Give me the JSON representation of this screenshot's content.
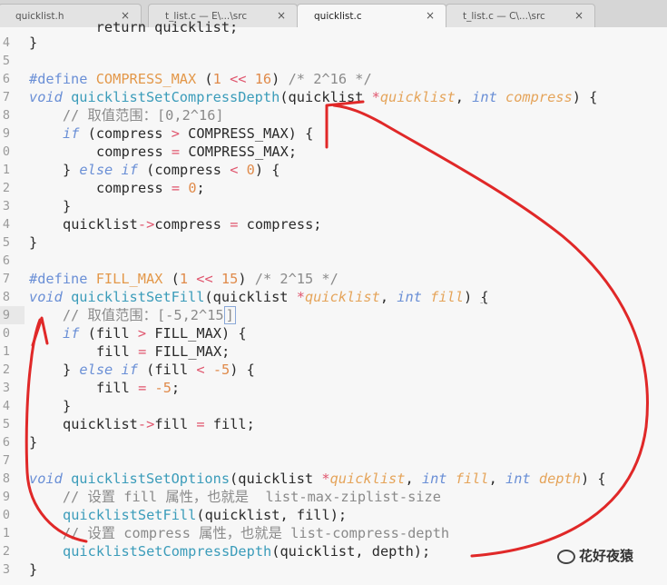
{
  "tabs": [
    {
      "label": "quicklist.h",
      "active": false
    },
    {
      "label": "t_list.c — E\\...\\src",
      "active": false
    },
    {
      "label": "quicklist.c",
      "active": true
    },
    {
      "label": "t_list.c — C\\...\\src",
      "active": false
    }
  ],
  "tab_close_glyph": "×",
  "line_numbers": [
    "4",
    "5",
    "6",
    "7",
    "8",
    "9",
    "0",
    "1",
    "2",
    "3",
    "4",
    "5",
    "6",
    "7",
    "8",
    "9",
    "0",
    "1",
    "2",
    "3",
    "4",
    "5",
    "6",
    "7",
    "8",
    "9",
    "0",
    "1",
    "2",
    "3"
  ],
  "code": {
    "l0_top": "        return quicklist;",
    "l1_brace": "}",
    "l3_define": "#define",
    "l3_name": "COMPRESS_MAX",
    "l3_open": "(",
    "l3_n1": "1",
    "l3_shift": "<<",
    "l3_n2": "16",
    "l3_close": ")",
    "l3_comment": "/* 2^16 */",
    "l4_void": "void",
    "l4_fn": "quicklistSetCompressDepth",
    "l4_open": "(quicklist ",
    "l4_star": "*",
    "l4_p1": "quicklist",
    "l4_comma": ", ",
    "l4_int": "int",
    "l4_p2": "compress",
    "l4_end": ") {",
    "l5_comment": "    // 取值范围：[0,2^16]",
    "l6_if": "if",
    "l6_a": " (compress ",
    "l6_gt": ">",
    "l6_b": " COMPRESS_MAX) {",
    "l7_a": "compress ",
    "l7_eq": "=",
    "l7_b": " COMPRESS_MAX;",
    "l8_a": "} ",
    "l8_else": "else",
    "l8_if": "if",
    "l8_b": " (compress ",
    "l8_lt": "<",
    "l8_n": "0",
    "l8_c": ") {",
    "l9_a": "compress ",
    "l9_eq": "=",
    "l9_n": "0",
    "l9_semi": ";",
    "l10_brace": "}",
    "l11_a": "quicklist",
    "l11_arrow": "->",
    "l11_b": "compress ",
    "l11_eq": "=",
    "l11_c": " compress;",
    "l12_brace": "}",
    "l14_define": "#define",
    "l14_name": "FILL_MAX",
    "l14_open": "(",
    "l14_n1": "1",
    "l14_shift": "<<",
    "l14_n2": "15",
    "l14_close": ")",
    "l14_comment": "/* 2^15 */",
    "l15_void": "void",
    "l15_fn": "quicklistSetFill",
    "l15_open": "(quicklist ",
    "l15_star": "*",
    "l15_p1": "quicklist",
    "l15_comma": ", ",
    "l15_int": "int",
    "l15_p2": "fill",
    "l15_end": ") ",
    "l15_brace": "{",
    "l16_comment": "    // 取值范围：[-5,2^15",
    "l16_bracket": "]",
    "l17_if": "if",
    "l17_a": " (fill ",
    "l17_gt": ">",
    "l17_b": " FILL_MAX) {",
    "l18_a": "fill ",
    "l18_eq": "=",
    "l18_b": " FILL_MAX;",
    "l19_a": "} ",
    "l19_else": "else",
    "l19_if": "if",
    "l19_b": " (fill ",
    "l19_lt": "<",
    "l19_n": "-5",
    "l19_c": ") {",
    "l20_a": "fill ",
    "l20_eq": "=",
    "l20_n": "-5",
    "l20_semi": ";",
    "l21_brace": "}",
    "l22_a": "quicklist",
    "l22_arrow": "->",
    "l22_b": "fill ",
    "l22_eq": "=",
    "l22_c": " fill;",
    "l23_brace": "}",
    "l25_void": "void",
    "l25_fn": "quicklistSetOptions",
    "l25_open": "(quicklist ",
    "l25_star": "*",
    "l25_p1": "quicklist",
    "l25_c1": ", ",
    "l25_int1": "int",
    "l25_p2": "fill",
    "l25_c2": ", ",
    "l25_int2": "int",
    "l25_p3": "depth",
    "l25_end": ") {",
    "l26_comment": "    // 设置 fill 属性，也就是  list-max-ziplist-size",
    "l27_fn": "quicklistSetFill",
    "l27_args": "(quicklist, fill);",
    "l28_comment": "    // 设置 compress 属性，也就是 list-compress-depth",
    "l29_fn": "quicklistSetCompressDepth",
    "l29_args": "(quicklist, depth);",
    "l30_brace": "}"
  },
  "watermark": "花好夜猿",
  "annotation_color": "#e02828"
}
